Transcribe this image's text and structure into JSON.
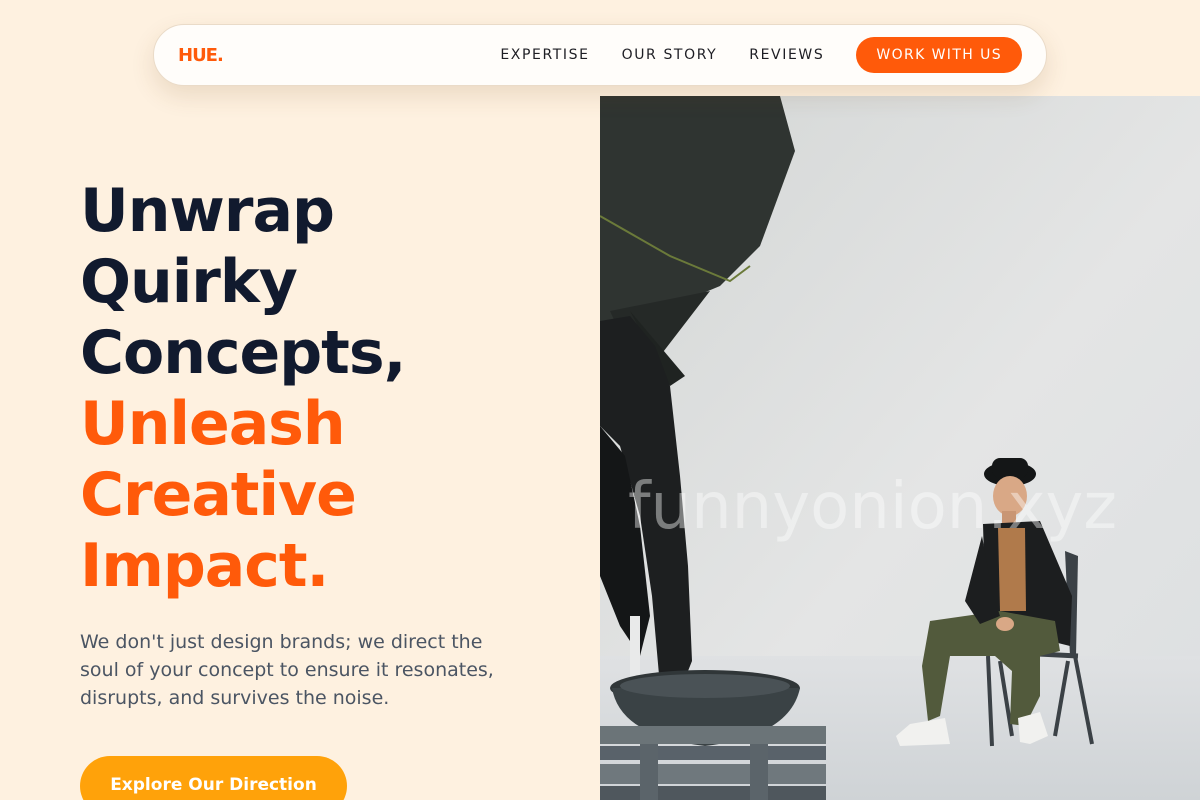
{
  "nav": {
    "logo": "HUE.",
    "links": [
      {
        "label": "EXPERTISE"
      },
      {
        "label": "OUR STORY"
      },
      {
        "label": "REVIEWS"
      }
    ],
    "cta": "WORK WITH US"
  },
  "hero": {
    "headline_dark": [
      "Unwrap",
      "Quirky",
      "Concepts,"
    ],
    "headline_accent": [
      "Unleash",
      "Creative",
      "Impact."
    ],
    "subtitle": "We don't just design brands; we direct the soul of your concept to ensure it resonates, disrupts, and survives the noise.",
    "cta": "Explore Our Direction"
  },
  "photo": {
    "subject": "studio-photo-man-on-chair",
    "watermark": "funnyonion.xyz"
  },
  "colors": {
    "background": "#fef1e0",
    "accent": "#ff5a0a",
    "cta_yellow": "#ffa20a",
    "headline_dark": "#111a2e",
    "body_text": "#4b5563"
  }
}
